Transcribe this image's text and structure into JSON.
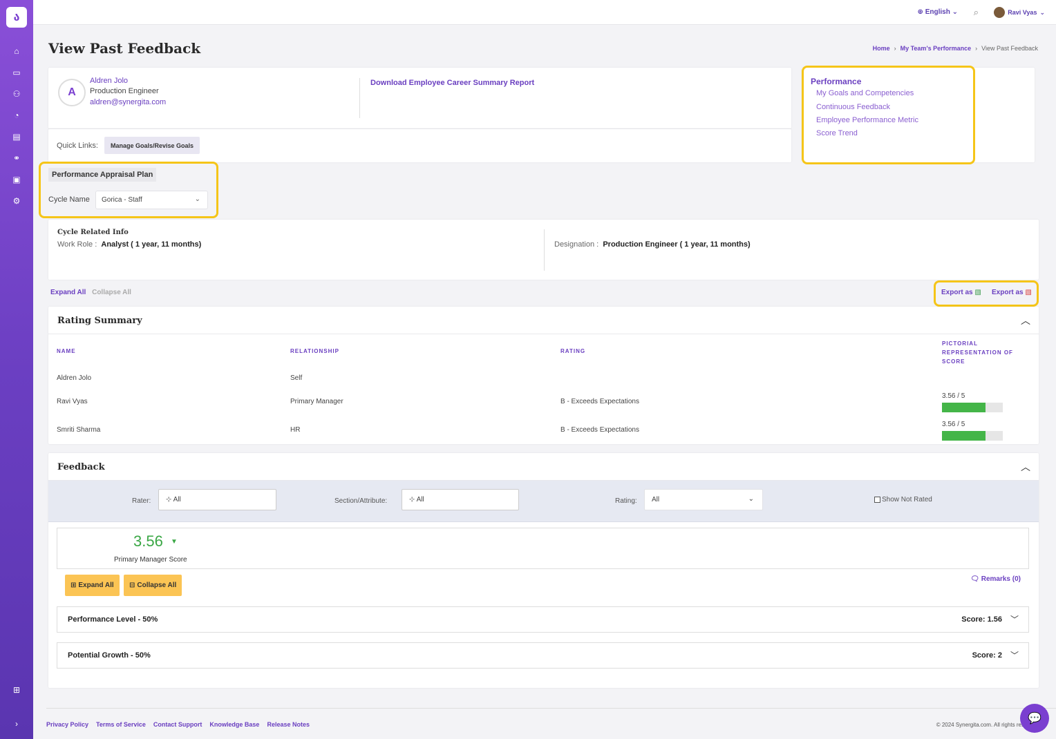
{
  "topbar": {
    "language": "English",
    "user_name": "Ravi Vyas"
  },
  "page": {
    "title": "View Past Feedback"
  },
  "breadcrumb": {
    "home": "Home",
    "team": "My Team's Performance",
    "current": "View Past Feedback"
  },
  "employee": {
    "initial": "A",
    "name": "Aldren Jolo",
    "role": "Production Engineer",
    "email": "aldren@synergita.com",
    "download_label": "Download Employee Career Summary Report"
  },
  "quick_links": {
    "label": "Quick Links:",
    "button": "Manage Goals/Revise Goals"
  },
  "performance": {
    "title": "Performance",
    "links": [
      "My Goals and Competencies",
      "Continuous Feedback",
      "Employee Performance Metric",
      "Score Trend"
    ]
  },
  "plan": {
    "badge": "Performance Appraisal Plan",
    "cycle_label": "Cycle Name",
    "cycle_value": "Gorica - Staff"
  },
  "cycle_info": {
    "heading": "Cycle Related Info",
    "work_role_label": "Work Role :",
    "work_role_value": "Analyst ( 1 year, 11 months)",
    "designation_label": "Designation :",
    "designation_value": "Production Engineer ( 1 year, 11 months)"
  },
  "controls": {
    "expand_all": "Expand All",
    "collapse_all": "Collapse All",
    "export_excel": "Export as",
    "export_pdf": "Export as"
  },
  "rating_summary": {
    "title": "Rating Summary",
    "headers": {
      "name": "NAME",
      "relationship": "RELATIONSHIP",
      "rating": "RATING",
      "pictorial": "PICTORIAL REPRESENTATION OF SCORE"
    },
    "rows": [
      {
        "name": "Aldren Jolo",
        "relationship": "Self",
        "rating": "",
        "score_text": "",
        "score_fraction": 0
      },
      {
        "name": "Ravi Vyas",
        "relationship": "Primary Manager",
        "rating": "B - Exceeds Expectations",
        "score_text": "3.56 / 5",
        "score_fraction": 0.712
      },
      {
        "name": "Smriti Sharma",
        "relationship": "HR",
        "rating": "B - Exceeds Expectations",
        "score_text": "3.56 / 5",
        "score_fraction": 0.712
      }
    ]
  },
  "feedback": {
    "title": "Feedback",
    "filters": {
      "rater_label": "Rater:",
      "rater_value": "All",
      "section_label": "Section/Attribute:",
      "section_value": "All",
      "rating_label": "Rating:",
      "rating_value": "All",
      "show_not_rated": "Show Not Rated"
    },
    "score": "3.56",
    "score_label": "Primary Manager Score",
    "expand_all": "Expand All",
    "collapse_all": "Collapse All",
    "remarks": "Remarks (0)",
    "sections": [
      {
        "title": "Performance Level - 50%",
        "score": "Score: 1.56"
      },
      {
        "title": "Potential Growth - 50%",
        "score": "Score: 2"
      }
    ]
  },
  "footer": {
    "links": [
      "Privacy Policy",
      "Terms of Service",
      "Contact Support",
      "Knowledge Base",
      "Release Notes"
    ],
    "copyright": "© 2024 Synergita.com. All rights res"
  },
  "colors": {
    "accent": "#6a3fc0",
    "highlight": "#f5c518",
    "score_green": "#3aa745",
    "button_yellow": "#fbc454"
  }
}
